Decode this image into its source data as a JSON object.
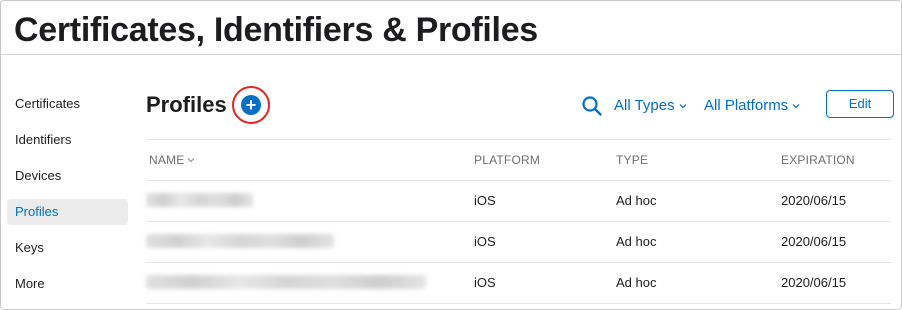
{
  "header": {
    "title": "Certificates, Identifiers & Profiles"
  },
  "sidebar": {
    "items": [
      {
        "label": "Certificates",
        "active": false
      },
      {
        "label": "Identifiers",
        "active": false
      },
      {
        "label": "Devices",
        "active": false
      },
      {
        "label": "Profiles",
        "active": true
      },
      {
        "label": "Keys",
        "active": false
      },
      {
        "label": "More",
        "active": false
      }
    ]
  },
  "section": {
    "title": "Profiles",
    "add_button_icon": "plus-circle-icon",
    "add_button_label": "+"
  },
  "toolbar": {
    "search_icon": "search-icon",
    "filter_types": "All Types",
    "filter_platforms": "All Platforms",
    "edit_label": "Edit"
  },
  "table": {
    "columns": {
      "name": "NAME",
      "platform": "PLATFORM",
      "type": "TYPE",
      "expiration": "EXPIRATION"
    },
    "rows": [
      {
        "name": "",
        "platform": "iOS",
        "type": "Ad hoc",
        "expiration": "2020/06/15"
      },
      {
        "name": "",
        "platform": "iOS",
        "type": "Ad hoc",
        "expiration": "2020/06/15"
      },
      {
        "name": "",
        "platform": "iOS",
        "type": "Ad hoc",
        "expiration": "2020/06/15"
      }
    ]
  },
  "colors": {
    "accent": "#0070c9",
    "highlight": "#e3261c",
    "active_bg": "#ececec"
  }
}
